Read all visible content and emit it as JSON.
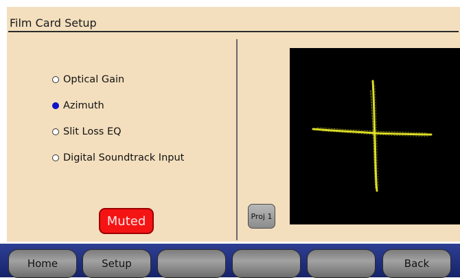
{
  "header": {
    "title": "Film Card Setup"
  },
  "options": [
    {
      "label": "Optical Gain",
      "selected": false
    },
    {
      "label": "Azimuth",
      "selected": true
    },
    {
      "label": "Slit Loss EQ",
      "selected": false
    },
    {
      "label": "Digital Soundtrack Input",
      "selected": false
    }
  ],
  "status": {
    "muted_label": "Muted",
    "muted_color": "#f51414"
  },
  "projector": {
    "button_label": "Proj 1"
  },
  "scope": {
    "trace_color": "#e8e82a",
    "background": "#000000"
  },
  "navbar": {
    "buttons": [
      {
        "label": "Home"
      },
      {
        "label": "Setup"
      },
      {
        "label": ""
      },
      {
        "label": ""
      },
      {
        "label": ""
      },
      {
        "label": "Back"
      }
    ]
  }
}
